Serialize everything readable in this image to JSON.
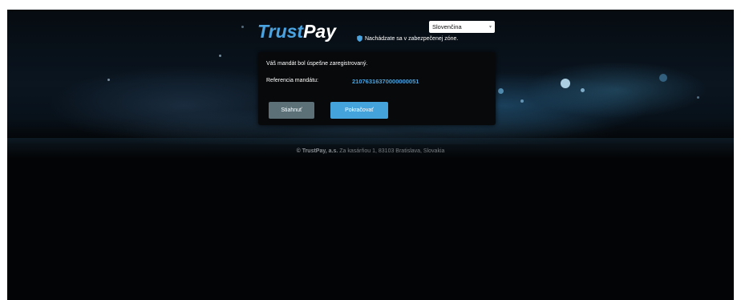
{
  "brand": {
    "logo_trust": "Trust",
    "logo_pay": "Pay"
  },
  "language": {
    "selected": "Slovenčina",
    "icon": "chevron-down-icon"
  },
  "secure_notice": {
    "text": "Nachádzate sa v zabezpečenej zóne.",
    "icon": "shield-icon"
  },
  "result": {
    "message": "Váš mandát bol úspešne zaregistrovaný.",
    "reference_label": "Referencia mandátu:",
    "reference_value": "21076316370000000051"
  },
  "actions": {
    "download_label": "Stiahnuť",
    "continue_label": "Pokračovať"
  },
  "footer": {
    "company": "© TrustPay, a.s.",
    "address": " Za kasárňou 1, 83103 Bratislava, Slovakia"
  },
  "colors": {
    "accent": "#4aa3df",
    "download_button": "#5b7077",
    "continue_button": "#45a3dc",
    "background": "#030405"
  }
}
